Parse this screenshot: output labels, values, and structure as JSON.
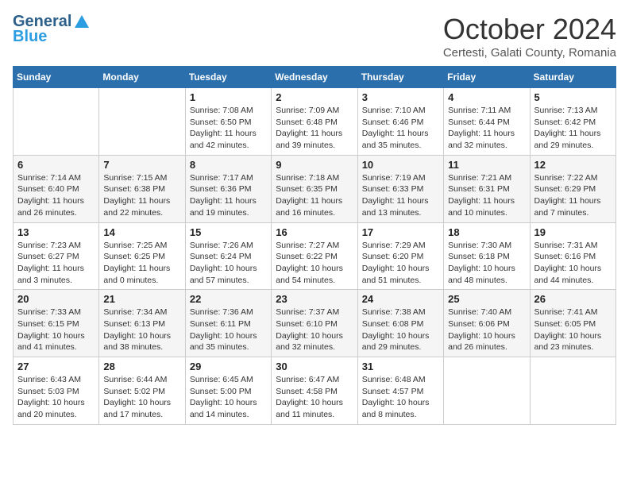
{
  "header": {
    "logo_general": "General",
    "logo_blue": "Blue",
    "title": "October 2024",
    "subtitle": "Certesti, Galati County, Romania"
  },
  "weekdays": [
    "Sunday",
    "Monday",
    "Tuesday",
    "Wednesday",
    "Thursday",
    "Friday",
    "Saturday"
  ],
  "weeks": [
    [
      {
        "day": "",
        "sunrise": "",
        "sunset": "",
        "daylight": ""
      },
      {
        "day": "",
        "sunrise": "",
        "sunset": "",
        "daylight": ""
      },
      {
        "day": "1",
        "sunrise": "Sunrise: 7:08 AM",
        "sunset": "Sunset: 6:50 PM",
        "daylight": "Daylight: 11 hours and 42 minutes."
      },
      {
        "day": "2",
        "sunrise": "Sunrise: 7:09 AM",
        "sunset": "Sunset: 6:48 PM",
        "daylight": "Daylight: 11 hours and 39 minutes."
      },
      {
        "day": "3",
        "sunrise": "Sunrise: 7:10 AM",
        "sunset": "Sunset: 6:46 PM",
        "daylight": "Daylight: 11 hours and 35 minutes."
      },
      {
        "day": "4",
        "sunrise": "Sunrise: 7:11 AM",
        "sunset": "Sunset: 6:44 PM",
        "daylight": "Daylight: 11 hours and 32 minutes."
      },
      {
        "day": "5",
        "sunrise": "Sunrise: 7:13 AM",
        "sunset": "Sunset: 6:42 PM",
        "daylight": "Daylight: 11 hours and 29 minutes."
      }
    ],
    [
      {
        "day": "6",
        "sunrise": "Sunrise: 7:14 AM",
        "sunset": "Sunset: 6:40 PM",
        "daylight": "Daylight: 11 hours and 26 minutes."
      },
      {
        "day": "7",
        "sunrise": "Sunrise: 7:15 AM",
        "sunset": "Sunset: 6:38 PM",
        "daylight": "Daylight: 11 hours and 22 minutes."
      },
      {
        "day": "8",
        "sunrise": "Sunrise: 7:17 AM",
        "sunset": "Sunset: 6:36 PM",
        "daylight": "Daylight: 11 hours and 19 minutes."
      },
      {
        "day": "9",
        "sunrise": "Sunrise: 7:18 AM",
        "sunset": "Sunset: 6:35 PM",
        "daylight": "Daylight: 11 hours and 16 minutes."
      },
      {
        "day": "10",
        "sunrise": "Sunrise: 7:19 AM",
        "sunset": "Sunset: 6:33 PM",
        "daylight": "Daylight: 11 hours and 13 minutes."
      },
      {
        "day": "11",
        "sunrise": "Sunrise: 7:21 AM",
        "sunset": "Sunset: 6:31 PM",
        "daylight": "Daylight: 11 hours and 10 minutes."
      },
      {
        "day": "12",
        "sunrise": "Sunrise: 7:22 AM",
        "sunset": "Sunset: 6:29 PM",
        "daylight": "Daylight: 11 hours and 7 minutes."
      }
    ],
    [
      {
        "day": "13",
        "sunrise": "Sunrise: 7:23 AM",
        "sunset": "Sunset: 6:27 PM",
        "daylight": "Daylight: 11 hours and 3 minutes."
      },
      {
        "day": "14",
        "sunrise": "Sunrise: 7:25 AM",
        "sunset": "Sunset: 6:25 PM",
        "daylight": "Daylight: 11 hours and 0 minutes."
      },
      {
        "day": "15",
        "sunrise": "Sunrise: 7:26 AM",
        "sunset": "Sunset: 6:24 PM",
        "daylight": "Daylight: 10 hours and 57 minutes."
      },
      {
        "day": "16",
        "sunrise": "Sunrise: 7:27 AM",
        "sunset": "Sunset: 6:22 PM",
        "daylight": "Daylight: 10 hours and 54 minutes."
      },
      {
        "day": "17",
        "sunrise": "Sunrise: 7:29 AM",
        "sunset": "Sunset: 6:20 PM",
        "daylight": "Daylight: 10 hours and 51 minutes."
      },
      {
        "day": "18",
        "sunrise": "Sunrise: 7:30 AM",
        "sunset": "Sunset: 6:18 PM",
        "daylight": "Daylight: 10 hours and 48 minutes."
      },
      {
        "day": "19",
        "sunrise": "Sunrise: 7:31 AM",
        "sunset": "Sunset: 6:16 PM",
        "daylight": "Daylight: 10 hours and 44 minutes."
      }
    ],
    [
      {
        "day": "20",
        "sunrise": "Sunrise: 7:33 AM",
        "sunset": "Sunset: 6:15 PM",
        "daylight": "Daylight: 10 hours and 41 minutes."
      },
      {
        "day": "21",
        "sunrise": "Sunrise: 7:34 AM",
        "sunset": "Sunset: 6:13 PM",
        "daylight": "Daylight: 10 hours and 38 minutes."
      },
      {
        "day": "22",
        "sunrise": "Sunrise: 7:36 AM",
        "sunset": "Sunset: 6:11 PM",
        "daylight": "Daylight: 10 hours and 35 minutes."
      },
      {
        "day": "23",
        "sunrise": "Sunrise: 7:37 AM",
        "sunset": "Sunset: 6:10 PM",
        "daylight": "Daylight: 10 hours and 32 minutes."
      },
      {
        "day": "24",
        "sunrise": "Sunrise: 7:38 AM",
        "sunset": "Sunset: 6:08 PM",
        "daylight": "Daylight: 10 hours and 29 minutes."
      },
      {
        "day": "25",
        "sunrise": "Sunrise: 7:40 AM",
        "sunset": "Sunset: 6:06 PM",
        "daylight": "Daylight: 10 hours and 26 minutes."
      },
      {
        "day": "26",
        "sunrise": "Sunrise: 7:41 AM",
        "sunset": "Sunset: 6:05 PM",
        "daylight": "Daylight: 10 hours and 23 minutes."
      }
    ],
    [
      {
        "day": "27",
        "sunrise": "Sunrise: 6:43 AM",
        "sunset": "Sunset: 5:03 PM",
        "daylight": "Daylight: 10 hours and 20 minutes."
      },
      {
        "day": "28",
        "sunrise": "Sunrise: 6:44 AM",
        "sunset": "Sunset: 5:02 PM",
        "daylight": "Daylight: 10 hours and 17 minutes."
      },
      {
        "day": "29",
        "sunrise": "Sunrise: 6:45 AM",
        "sunset": "Sunset: 5:00 PM",
        "daylight": "Daylight: 10 hours and 14 minutes."
      },
      {
        "day": "30",
        "sunrise": "Sunrise: 6:47 AM",
        "sunset": "Sunset: 4:58 PM",
        "daylight": "Daylight: 10 hours and 11 minutes."
      },
      {
        "day": "31",
        "sunrise": "Sunrise: 6:48 AM",
        "sunset": "Sunset: 4:57 PM",
        "daylight": "Daylight: 10 hours and 8 minutes."
      },
      {
        "day": "",
        "sunrise": "",
        "sunset": "",
        "daylight": ""
      },
      {
        "day": "",
        "sunrise": "",
        "sunset": "",
        "daylight": ""
      }
    ]
  ]
}
